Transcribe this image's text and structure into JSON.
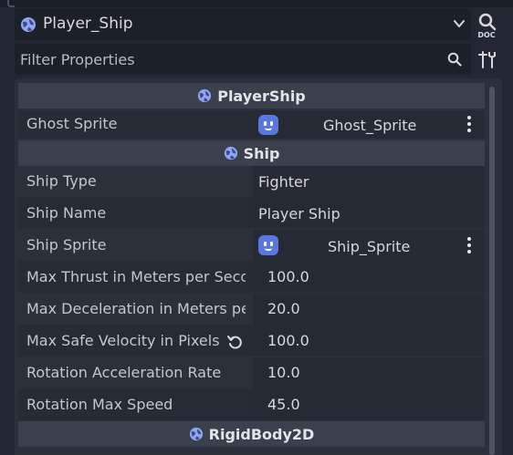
{
  "header": {
    "object_name": "Player_Ship",
    "doc_label": "DOC",
    "filter_placeholder": "Filter Properties"
  },
  "sections": {
    "player_ship": {
      "title": "PlayerShip"
    },
    "ship": {
      "title": "Ship"
    },
    "rigid_body": {
      "title": "RigidBody2D"
    }
  },
  "properties": {
    "ghost_sprite": {
      "label": "Ghost Sprite",
      "value": "Ghost_Sprite"
    },
    "ship_type": {
      "label": "Ship Type",
      "value": "Fighter"
    },
    "ship_name": {
      "label": "Ship Name",
      "value": "Player Ship"
    },
    "ship_sprite": {
      "label": "Ship Sprite",
      "value": "Ship_Sprite"
    },
    "max_thrust": {
      "label": "Max Thrust in Meters per Secon",
      "value": "100.0"
    },
    "max_decel": {
      "label": "Max Deceleration in Meters per",
      "value": "20.0"
    },
    "max_safe_velocity": {
      "label": "Max Safe Velocity in Pixels p",
      "value": "100.0"
    },
    "rotation_accel": {
      "label": "Rotation Acceleration Rate",
      "value": "10.0"
    },
    "rotation_max_speed": {
      "label": "Rotation Max Speed",
      "value": "45.0"
    }
  },
  "icons": {
    "object": "globe-icon",
    "dropdown": "chevron-down-icon",
    "doc": "doc-icon",
    "search": "search-icon",
    "tools": "tools-icon",
    "texture": "texture-icon",
    "menu": "kebab-menu-icon",
    "revert": "revert-icon"
  },
  "colors": {
    "background": "#222733",
    "panel": "#2b303b",
    "section_header": "#3a404c",
    "accent_icon": "#5a77e0",
    "text": "#cdcfd2"
  }
}
